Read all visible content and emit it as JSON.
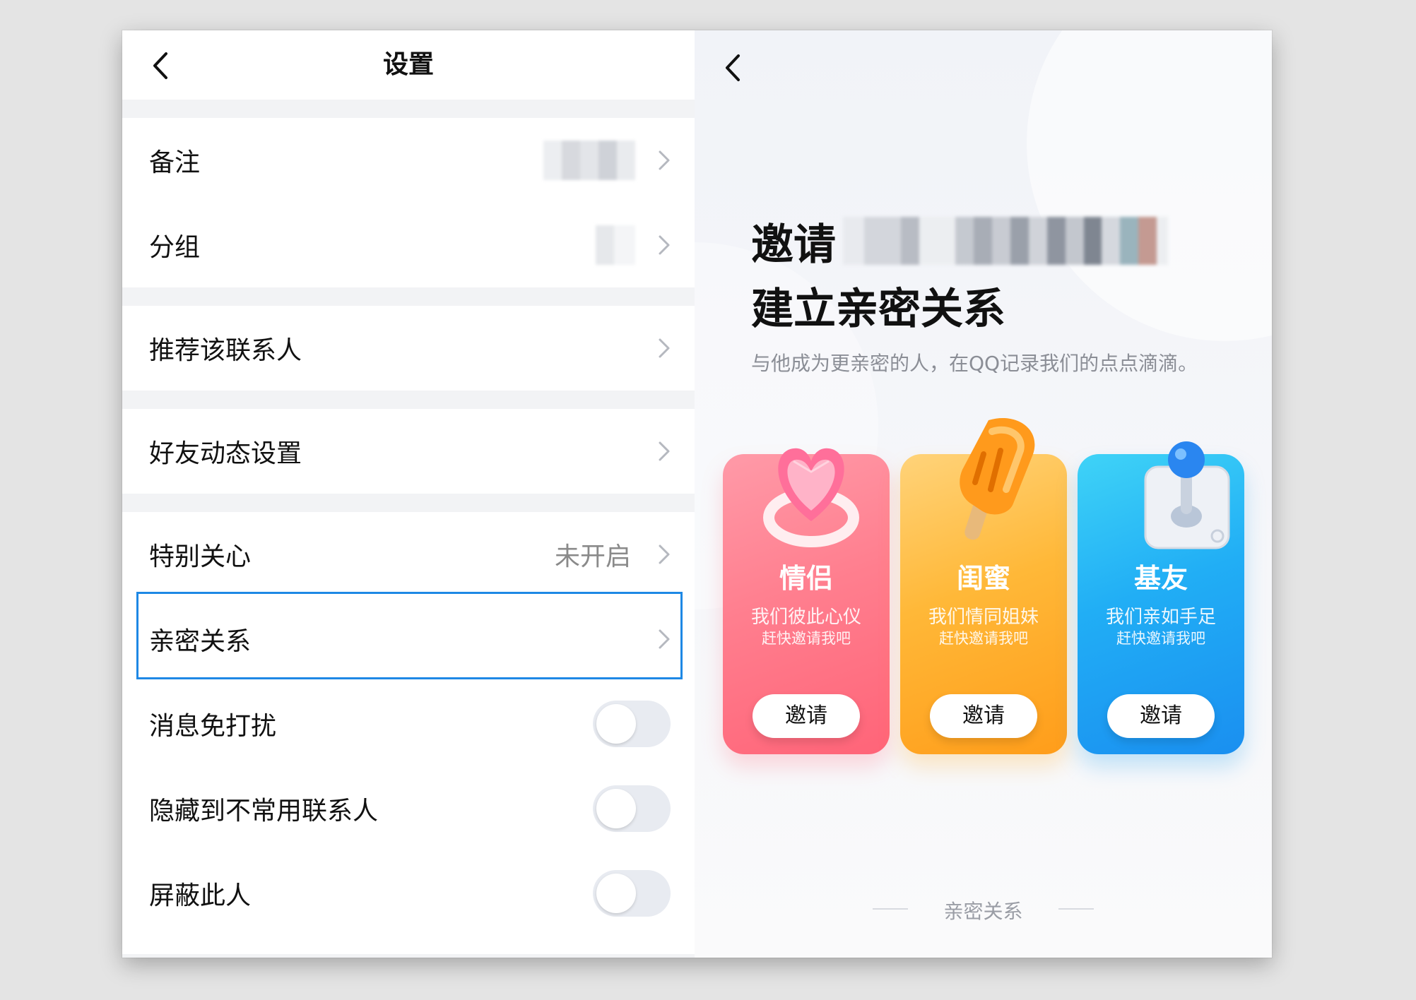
{
  "settings": {
    "title": "设置",
    "rows": {
      "note": {
        "label": "备注"
      },
      "group": {
        "label": "分组"
      },
      "recommend": {
        "label": "推荐该联系人"
      },
      "friend_feed": {
        "label": "好友动态设置"
      },
      "special_care": {
        "label": "特别关心",
        "value": "未开启"
      },
      "intimate": {
        "label": "亲密关系"
      },
      "mute": {
        "label": "消息免打扰",
        "on": false
      },
      "hide": {
        "label": "隐藏到不常用联系人",
        "on": false
      },
      "block": {
        "label": "屏蔽此人",
        "on": false
      }
    }
  },
  "intimate_page": {
    "invite_word": "邀请",
    "title_line2": "建立亲密关系",
    "subtitle": "与他成为更亲密的人，在QQ记录我们的点点滴滴。",
    "cards": [
      {
        "title": "情侣",
        "line1": "我们彼此心仪",
        "line2": "赶快邀请我吧",
        "button": "邀请",
        "icon": "heart-icon",
        "color": "#ff6f86"
      },
      {
        "title": "闺蜜",
        "line1": "我们情同姐妹",
        "line2": "赶快邀请我吧",
        "button": "邀请",
        "icon": "popsicle-icon",
        "color": "#ffab1f"
      },
      {
        "title": "基友",
        "line1": "我们亲如手足",
        "line2": "赶快邀请我吧",
        "button": "邀请",
        "icon": "joystick-icon",
        "color": "#1aa4f5"
      }
    ],
    "footer": "亲密关系"
  }
}
